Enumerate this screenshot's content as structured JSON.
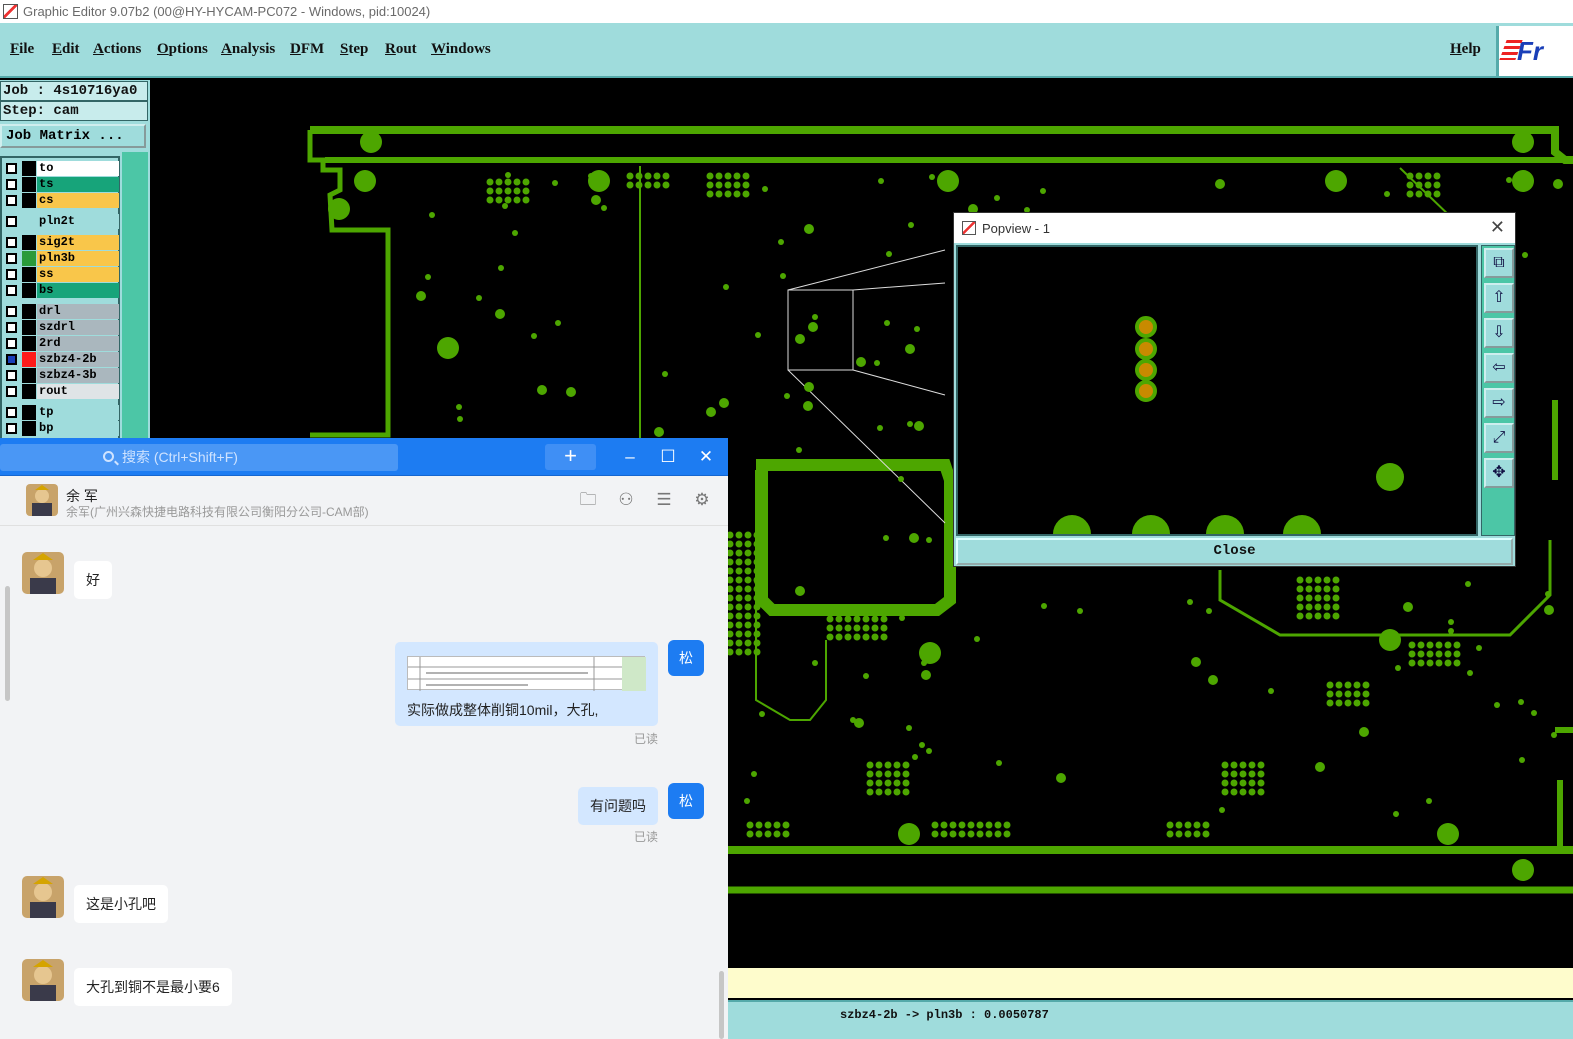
{
  "window": {
    "title": "Graphic Editor 9.07b2 (00@HY-HYCAM-PC072 - Windows, pid:10024)"
  },
  "menu": {
    "items": [
      "File",
      "Edit",
      "Actions",
      "Options",
      "Analysis",
      "DFM",
      "Step",
      "Rout",
      "Windows"
    ],
    "help": "Help",
    "logo_text": "Fr"
  },
  "job": {
    "job_label": "Job : 4s10716ya0",
    "step_label": "Step: cam",
    "matrix_button": "Job Matrix ..."
  },
  "layers": [
    {
      "name": "to",
      "color": "#ffffff",
      "swatch": "#000000"
    },
    {
      "name": "ts",
      "color": "#17a47a",
      "swatch": "#000000"
    },
    {
      "name": "cs",
      "color": "#f9c64a",
      "swatch": "#000000"
    },
    {
      "name": "pln2t",
      "color": "#9fdcdc",
      "swatch": "#9fdcdc"
    },
    {
      "name": "sig2t",
      "color": "#f9c64a",
      "swatch": "#000000"
    },
    {
      "name": "pln3b",
      "color": "#f9c64a",
      "swatch": "#2a9a3a"
    },
    {
      "name": "ss",
      "color": "#f9c64a",
      "swatch": "#000000"
    },
    {
      "name": "bs",
      "color": "#17a47a",
      "swatch": "#000000"
    },
    {
      "name": "drl",
      "color": "#aab7be",
      "swatch": "#000000"
    },
    {
      "name": "szdrl",
      "color": "#aab7be",
      "swatch": "#000000"
    },
    {
      "name": "2rd",
      "color": "#aab7be",
      "swatch": "#000000"
    },
    {
      "name": "szbz4-2b",
      "color": "#aab7be",
      "swatch": "#ff1a1a"
    },
    {
      "name": "szbz4-3b",
      "color": "#aab7be",
      "swatch": "#000000"
    },
    {
      "name": "rout",
      "color": "#dfe4e6",
      "swatch": "#000000"
    },
    {
      "name": "tp",
      "color": "#9fdcdc",
      "swatch": "#000000"
    },
    {
      "name": "bp",
      "color": "#9fdcdc",
      "swatch": "#000000"
    }
  ],
  "status": {
    "text": "szbz4-2b -> pln3b : 0.0050787"
  },
  "popview": {
    "title": "Popview - 1",
    "close_button": "Close",
    "tools": [
      "zoom-window-icon",
      "pan-up-icon",
      "pan-down-icon",
      "pan-left-icon",
      "pan-right-icon",
      "zoom-fit-icon",
      "zoom-home-icon"
    ]
  },
  "chat": {
    "search_placeholder": "搜索 (Ctrl+Shift+F)",
    "add_label": "+",
    "contact": {
      "name": "余 军",
      "org": "余军(广州兴森快捷电路科技有限公司衡阳分公司-CAM部)"
    },
    "my_avatar_text": "松",
    "messages": [
      {
        "side": "left",
        "text": "好"
      },
      {
        "side": "right",
        "type": "image",
        "text": "实际做成整体削铜10mil，大孔,",
        "read": "已读"
      },
      {
        "side": "right",
        "text": "有问题吗",
        "read": "已读"
      },
      {
        "side": "left",
        "text": "这是小孔吧"
      },
      {
        "side": "left",
        "text": "大孔到铜不是最小要6"
      }
    ]
  },
  "colors": {
    "menu_bg": "#9fdcdc",
    "pcb_trace": "#4da600",
    "chat_accent": "#1d7cf2",
    "pad_fill": "#c88a00"
  }
}
